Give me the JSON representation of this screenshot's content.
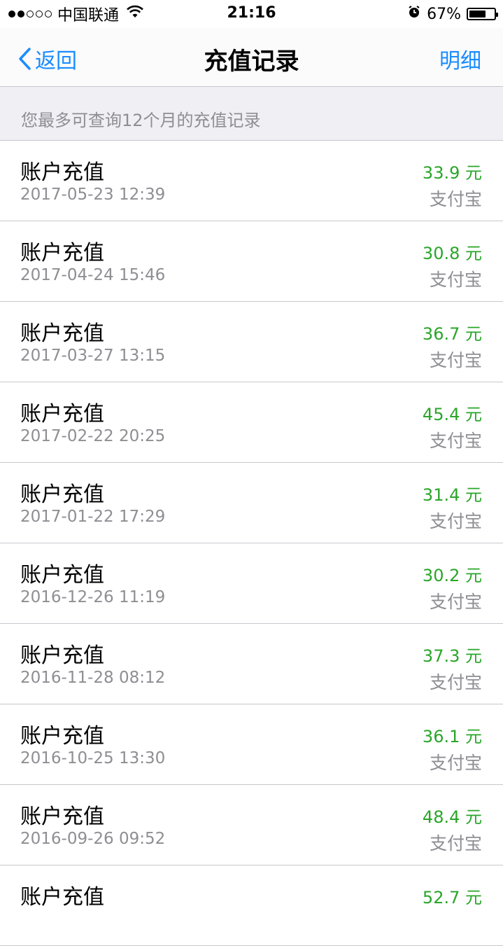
{
  "status_bar": {
    "carrier": "中国联通",
    "time": "21:16",
    "battery_percent": "67%",
    "battery_level": 0.67
  },
  "nav": {
    "back_label": "返回",
    "title": "充值记录",
    "detail_label": "明细"
  },
  "notice": "您最多可查询12个月的充值记录",
  "records": [
    {
      "title": "账户充值",
      "date": "2017-05-23 12:39",
      "amount": "33.9 元",
      "method": "支付宝"
    },
    {
      "title": "账户充值",
      "date": "2017-04-24 15:46",
      "amount": "30.8 元",
      "method": "支付宝"
    },
    {
      "title": "账户充值",
      "date": "2017-03-27 13:15",
      "amount": "36.7 元",
      "method": "支付宝"
    },
    {
      "title": "账户充值",
      "date": "2017-02-22 20:25",
      "amount": "45.4 元",
      "method": "支付宝"
    },
    {
      "title": "账户充值",
      "date": "2017-01-22 17:29",
      "amount": "31.4 元",
      "method": "支付宝"
    },
    {
      "title": "账户充值",
      "date": "2016-12-26 11:19",
      "amount": "30.2 元",
      "method": "支付宝"
    },
    {
      "title": "账户充值",
      "date": "2016-11-28 08:12",
      "amount": "37.3 元",
      "method": "支付宝"
    },
    {
      "title": "账户充值",
      "date": "2016-10-25 13:30",
      "amount": "36.1 元",
      "method": "支付宝"
    },
    {
      "title": "账户充值",
      "date": "2016-09-26 09:52",
      "amount": "48.4 元",
      "method": "支付宝"
    },
    {
      "title": "账户充值",
      "date": "",
      "amount": "52.7 元",
      "method": ""
    }
  ],
  "colors": {
    "accent": "#1a8cff",
    "amount_green": "#2aa52a"
  }
}
